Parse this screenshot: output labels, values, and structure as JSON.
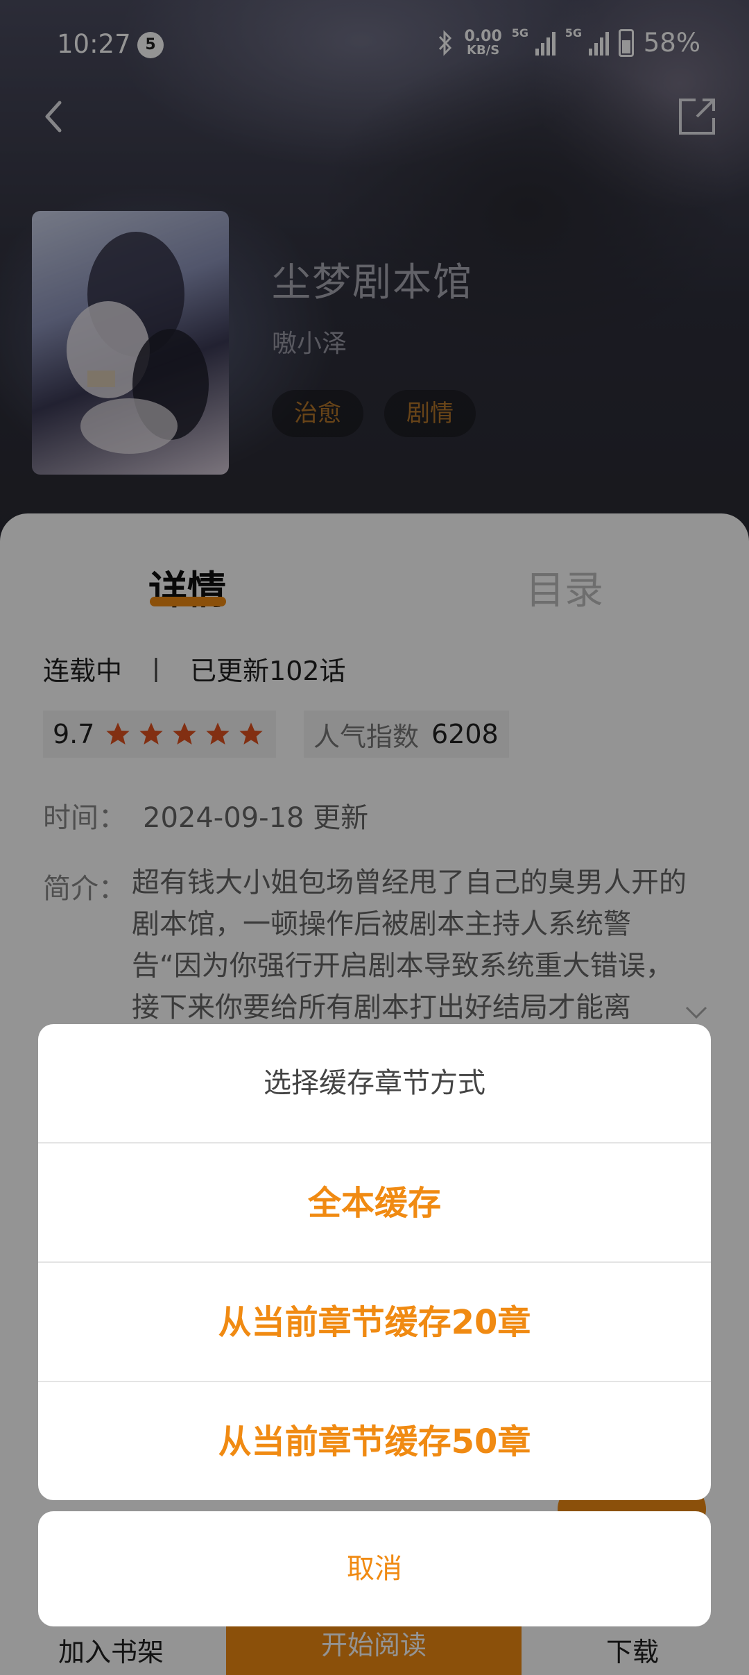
{
  "status_bar": {
    "time": "10:27",
    "notification_count": "5",
    "net_speed_value": "0.00",
    "net_speed_unit": "KB/S",
    "signal_1_label": "5G",
    "signal_2_label": "5G",
    "battery": "58%"
  },
  "nav": {
    "back_icon": "chevron-left-icon",
    "share_icon": "share-icon"
  },
  "book": {
    "title": "尘梦剧本馆",
    "author": "嗷小泽",
    "tags": [
      "治愈",
      "剧情"
    ]
  },
  "tabs": {
    "details": "详情",
    "catalog": "目录"
  },
  "details": {
    "status": "连载中",
    "separator": "丨",
    "updated": "已更新102话",
    "rating": "9.7",
    "stars": 5,
    "popularity_label": "人气指数",
    "popularity_value": "6208",
    "time_label": "时间：",
    "time_value": "2024-09-18 更新",
    "intro_label": "简介：",
    "intro_text": "超有钱大小姐包场曾经甩了自己的臭男人开的剧本馆，一顿操作后被剧本主持人系统警告“因为你强行开启剧本导致系统重大错误，接下来你要给所有剧本打出好结局才能离"
  },
  "action_sheet": {
    "title": "选择缓存章节方式",
    "options": [
      "全本缓存",
      "从当前章节缓存20章",
      "从当前章节缓存50章"
    ],
    "cancel": "取消"
  },
  "bottom_bar": {
    "shelf": "加入书架",
    "read": "开始阅读",
    "download": "下载"
  },
  "colors": {
    "accent": "#f08a12",
    "tag_text": "#b4762a",
    "sheet_bg": "#ffffff"
  }
}
